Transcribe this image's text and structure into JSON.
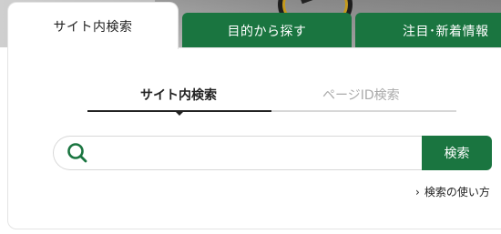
{
  "tabs": [
    {
      "label": "サイト内検索",
      "active": true
    },
    {
      "label": "目的から探す",
      "active": false
    },
    {
      "label": "注目･新着情報",
      "active": false
    }
  ],
  "subtabs": [
    {
      "label": "サイト内検索",
      "active": true
    },
    {
      "label": "ページID検索",
      "active": false
    }
  ],
  "search": {
    "value": "",
    "placeholder": "",
    "button_label": "検索",
    "icon": "search-icon"
  },
  "howto_link": {
    "label": "検索の使い方",
    "icon": "chevron-right-icon"
  },
  "colors": {
    "accent": "#1a7540",
    "tab_text": "#ffffff",
    "inactive_subtab": "#aaaaaa"
  }
}
